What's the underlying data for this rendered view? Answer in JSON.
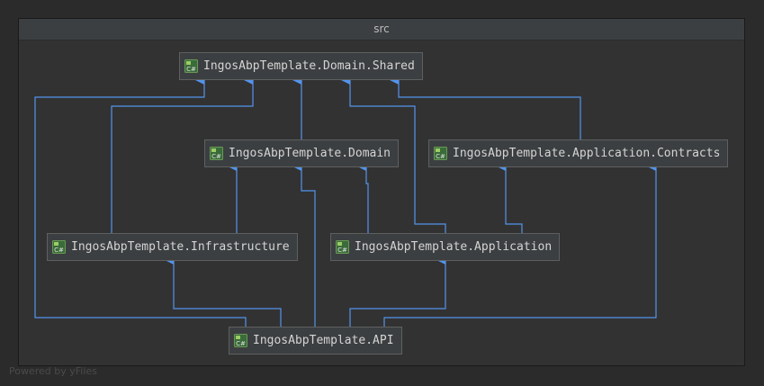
{
  "group": {
    "title": "src"
  },
  "nodes": {
    "domain_shared": {
      "label": "IngosAbpTemplate.Domain.Shared",
      "icon": "csharp-project-icon"
    },
    "domain": {
      "label": "IngosAbpTemplate.Domain",
      "icon": "csharp-project-icon"
    },
    "application_contracts": {
      "label": "IngosAbpTemplate.Application.Contracts",
      "icon": "csharp-project-icon"
    },
    "infrastructure": {
      "label": "IngosAbpTemplate.Infrastructure",
      "icon": "csharp-project-icon"
    },
    "application": {
      "label": "IngosAbpTemplate.Application",
      "icon": "csharp-project-icon"
    },
    "api": {
      "label": "IngosAbpTemplate.API",
      "icon": "csharp-project-icon"
    }
  },
  "dependencies": [
    {
      "from": "domain",
      "to": "domain_shared"
    },
    {
      "from": "application_contracts",
      "to": "domain_shared"
    },
    {
      "from": "infrastructure",
      "to": "domain_shared"
    },
    {
      "from": "application",
      "to": "domain_shared"
    },
    {
      "from": "api",
      "to": "domain_shared"
    },
    {
      "from": "infrastructure",
      "to": "domain"
    },
    {
      "from": "application",
      "to": "domain"
    },
    {
      "from": "api",
      "to": "domain"
    },
    {
      "from": "application",
      "to": "application_contracts"
    },
    {
      "from": "api",
      "to": "application_contracts"
    },
    {
      "from": "api",
      "to": "infrastructure"
    },
    {
      "from": "api",
      "to": "application"
    }
  ],
  "colors": {
    "edge": "#5394ec",
    "background": "#2b2b2b",
    "node": "#3c3f41"
  },
  "watermark": "Powered by yFiles"
}
